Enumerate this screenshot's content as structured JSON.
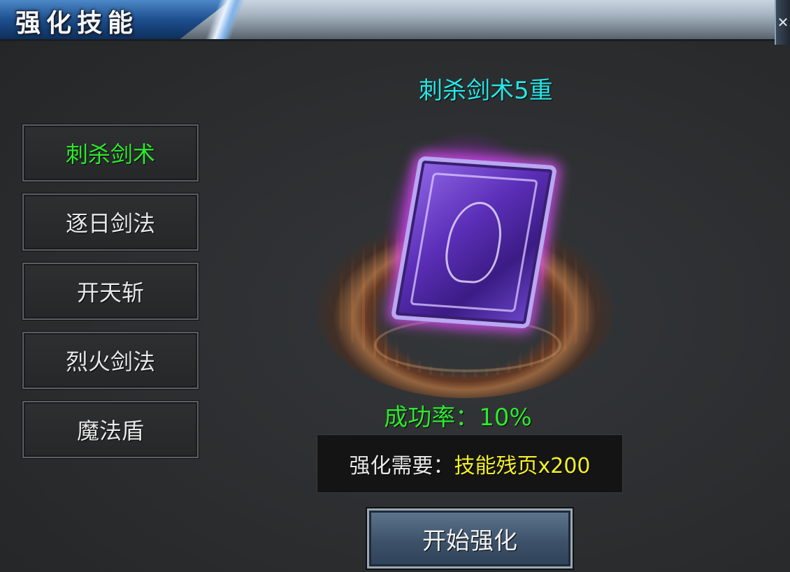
{
  "window": {
    "title": "强化技能",
    "close_glyph": "✕"
  },
  "skills": [
    {
      "label": "刺杀剑术",
      "selected": true
    },
    {
      "label": "逐日剑法",
      "selected": false
    },
    {
      "label": "开天斩",
      "selected": false
    },
    {
      "label": "烈火剑法",
      "selected": false
    },
    {
      "label": "魔法盾",
      "selected": false
    }
  ],
  "detail": {
    "skill_title": "刺杀剑术5重",
    "success_rate": "成功率：10%",
    "cost_label": "强化需要：",
    "cost_value": "技能残页x200",
    "start_button": "开始强化"
  },
  "colors": {
    "selected_text": "#2ee82e",
    "title_cyan": "#27e6e6",
    "cost_yellow": "#f4ef2a",
    "book_glow": "#e03cff"
  },
  "icons": {
    "book": "skill-book-icon"
  }
}
